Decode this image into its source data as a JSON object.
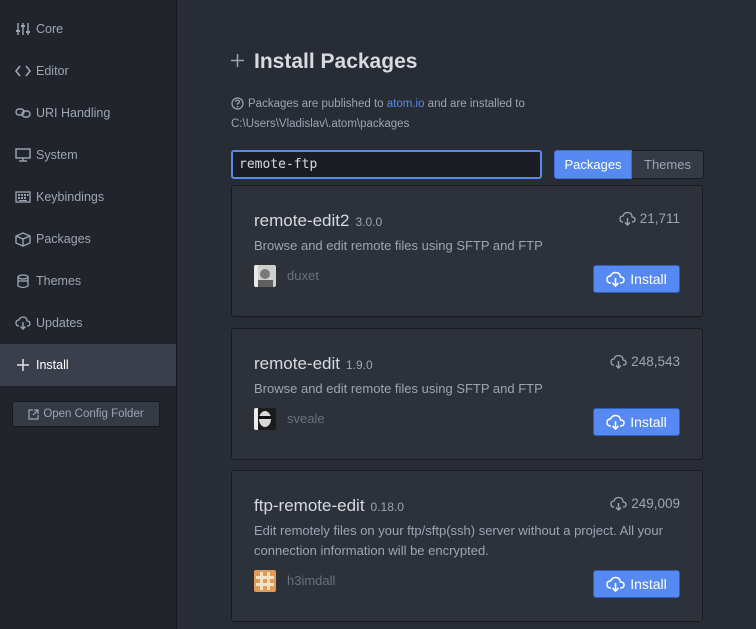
{
  "sidebar": {
    "items": [
      {
        "label": "Core",
        "icon": "sliders-icon"
      },
      {
        "label": "Editor",
        "icon": "code-icon"
      },
      {
        "label": "URI Handling",
        "icon": "link-icon"
      },
      {
        "label": "System",
        "icon": "monitor-icon"
      },
      {
        "label": "Keybindings",
        "icon": "keyboard-icon"
      },
      {
        "label": "Packages",
        "icon": "package-icon"
      },
      {
        "label": "Themes",
        "icon": "paintcan-icon"
      },
      {
        "label": "Updates",
        "icon": "cloud-download-icon"
      },
      {
        "label": "Install",
        "icon": "plus-icon",
        "active": true
      }
    ],
    "open_config_label": "Open Config Folder"
  },
  "install": {
    "title": "Install Packages",
    "info_prefix": "Packages are published to",
    "info_link": "atom.io",
    "info_suffix": "and are installed to",
    "info_path": "C:\\Users\\Vladislav\\.atom\\packages",
    "search_value": "remote-ftp",
    "toggle": {
      "packages": "Packages",
      "themes": "Themes",
      "selected": "Packages"
    }
  },
  "packages": [
    {
      "name": "remote-edit2",
      "version": "3.0.0",
      "downloads": "21,711",
      "description": "Browse and edit remote files using SFTP and FTP",
      "owner": "duxet",
      "install_label": "Install"
    },
    {
      "name": "remote-edit",
      "version": "1.9.0",
      "downloads": "248,543",
      "description": "Browse and edit remote files using SFTP and FTP",
      "owner": "sveale",
      "install_label": "Install"
    },
    {
      "name": "ftp-remote-edit",
      "version": "0.18.0",
      "downloads": "249,009",
      "description": "Edit remotely files on your ftp/sftp(ssh) server without a project. All your connection information will be encrypted.",
      "owner": "h3imdall",
      "install_label": "Install"
    }
  ],
  "colors": {
    "accent": "#568af2",
    "background": "#282c34",
    "sidebar": "#21252b",
    "card": "#2c313a"
  }
}
